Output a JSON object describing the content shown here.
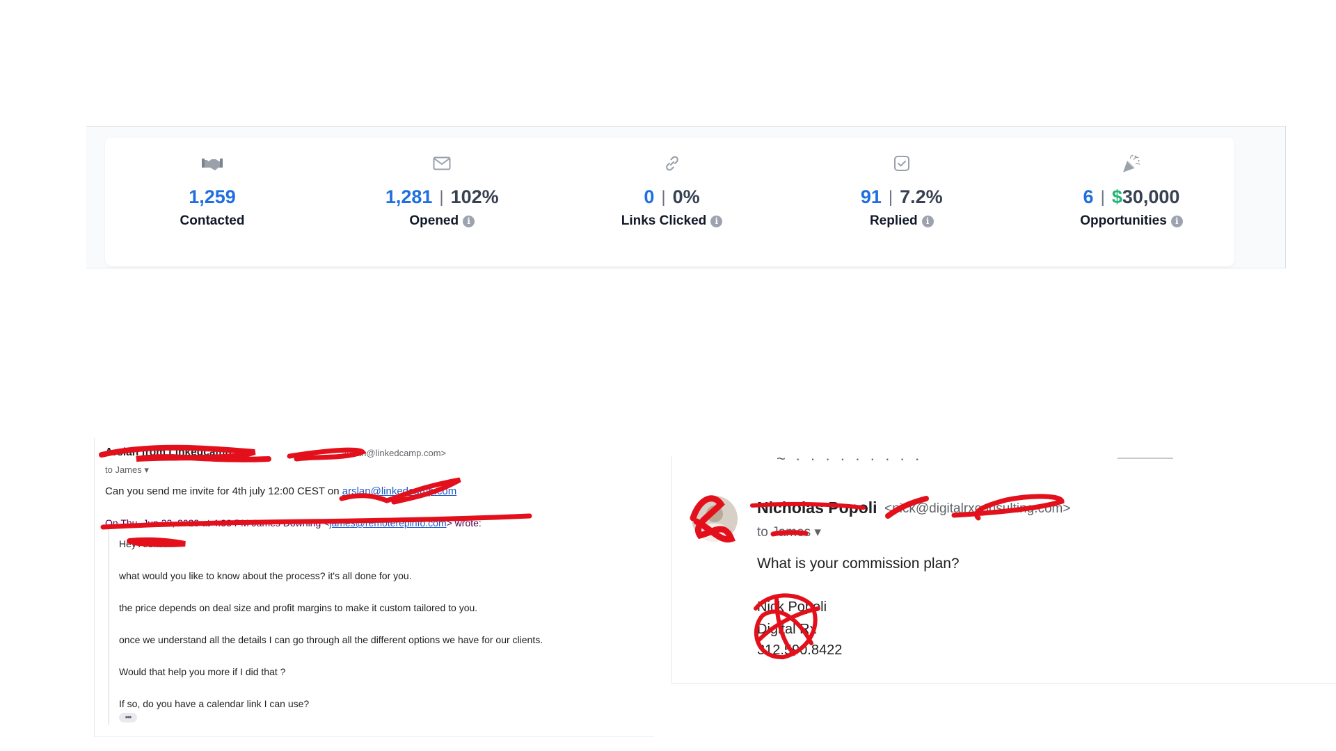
{
  "stats": [
    {
      "icon": "handshake-icon",
      "primary": "1,259",
      "secondary": "",
      "label": "Contacted",
      "info": false
    },
    {
      "icon": "envelope-icon",
      "primary": "1,281",
      "secondary": "102%",
      "label": "Opened",
      "info": true
    },
    {
      "icon": "link-icon",
      "primary": "0",
      "secondary": "0%",
      "label": "Links Clicked",
      "info": true
    },
    {
      "icon": "checkbox-icon",
      "primary": "91",
      "secondary": "7.2%",
      "label": "Replied",
      "info": true
    },
    {
      "icon": "party-popper-icon",
      "primary": "6",
      "secondary": "$30,000",
      "label": "Opportunities",
      "info": true
    }
  ],
  "colors": {
    "primary_value": "#1f6fe0",
    "money": "#22b573",
    "redaction": "#e3101b"
  },
  "email_left": {
    "sender": "Arslan from Linkedcamp",
    "sender_email": "arslan@linkedcamp.com>",
    "to": "to James",
    "body_text": "Can you send me invite for 4th july 12:00 CEST on ",
    "body_link": "arslan@linkedcamp.com",
    "quote_header_pre": "On Thu, Jun 22, 2023 at 4:33 PM James Downing <",
    "quote_header_link": "james@remoterepinfo.com",
    "quote_header_post": "> wrote:",
    "quote_lines": [
      "Hey Arslan",
      "what would you like to know about the process? it's all done for you.",
      "the price depends on deal size and profit margins to make it custom tailored to you.",
      "once we understand all the details I can go through all the different options we have for our clients.",
      "Would that help you more if I did that ?",
      "If so, do you have a calendar link I can use?"
    ],
    "ellipsis": "•••"
  },
  "email_right": {
    "sender": "Nicholas Popoli",
    "sender_email": "<nick@digitalrxconsulting.com>",
    "to": "to James",
    "body": "What is your commission plan?",
    "signature": [
      "Nick Popoli",
      "Digital Rx",
      "312.590.8422"
    ]
  }
}
